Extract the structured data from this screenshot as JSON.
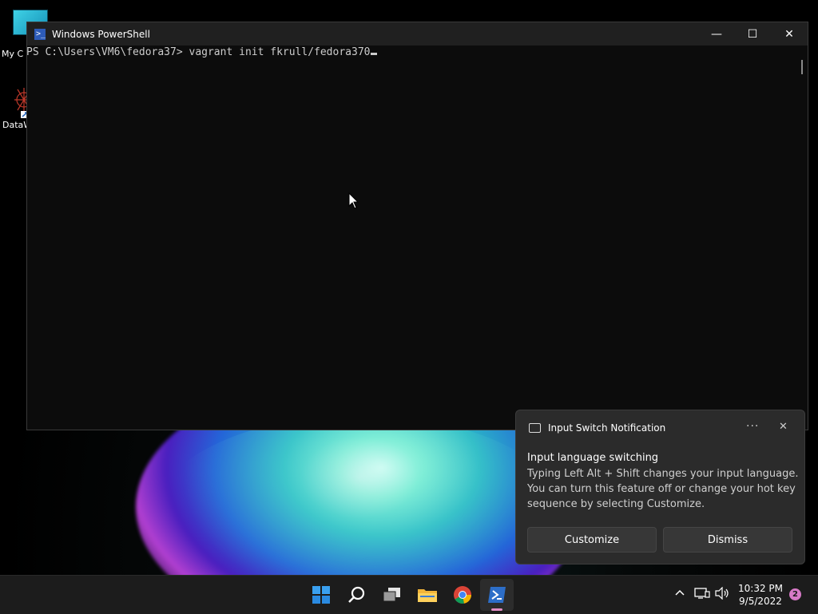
{
  "desktop": {
    "icons": [
      {
        "label": "My C"
      },
      {
        "label": "DataW"
      }
    ]
  },
  "powershell": {
    "title": "Windows PowerShell",
    "prompt": "PS C:\\Users\\VM6\\fedora37> ",
    "command": "vagrant init fkrull/fedora370",
    "min_glyph": "—",
    "max_glyph": "☐",
    "close_glyph": "✕"
  },
  "notification": {
    "app_name": "Input Switch Notification",
    "more_glyph": "···",
    "close_glyph": "✕",
    "title": "Input language switching",
    "body": "Typing Left Alt + Shift changes your input language. You can turn this feature off or change your hot key sequence by selecting Customize.",
    "buttons": [
      "Customize",
      "Dismiss"
    ]
  },
  "taskbar": {
    "apps": [
      "start-icon",
      "search-icon",
      "task-view-icon",
      "file-explorer-icon",
      "chrome-icon",
      "powershell-icon"
    ],
    "tray": {
      "chevron_glyph": "^",
      "time": "10:32 PM",
      "date": "9/5/2022",
      "notification_count": "2"
    }
  },
  "colors": {
    "terminal_bg": "#0c0c0c",
    "terminal_text": "#cccccc",
    "accent": "#d77ac7",
    "powershell_blue": "#2d5bb8"
  }
}
